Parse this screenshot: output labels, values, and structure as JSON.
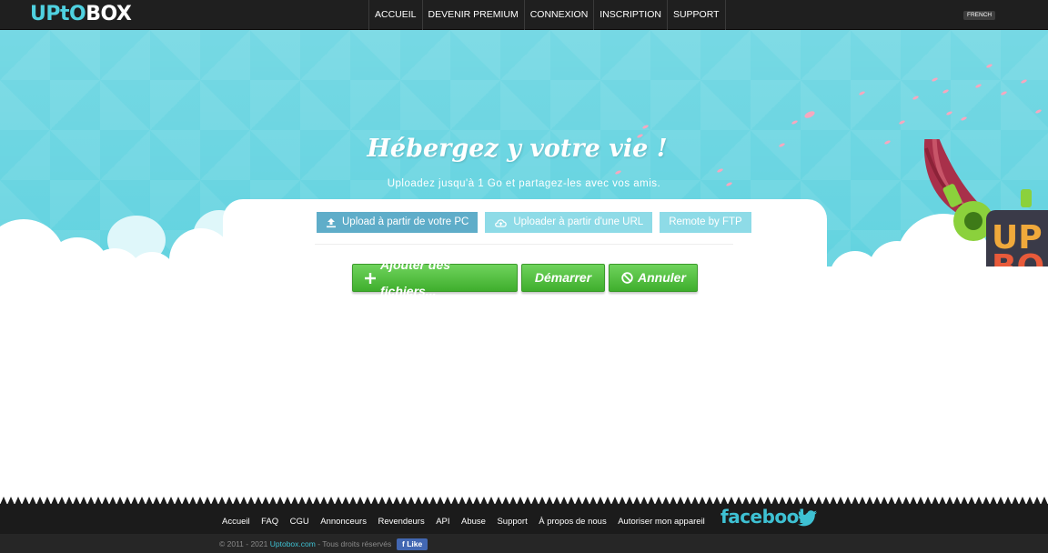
{
  "header": {
    "logo_part1": "UPtO",
    "logo_part2": "BOX",
    "nav": [
      {
        "label": "ACCUEIL"
      },
      {
        "label": "DEVENIR PREMIUM"
      },
      {
        "label": "CONNEXION"
      },
      {
        "label": "INSCRIPTION"
      },
      {
        "label": "SUPPORT"
      }
    ],
    "language": "FRENCH"
  },
  "hero": {
    "title": "Hébergez y votre vie !",
    "subtitle": "Uploadez jusqu'à 1 Go et partagez-les avec vos amis."
  },
  "upload": {
    "tabs": [
      {
        "label": "Upload à partir de votre PC",
        "icon": "upload-icon",
        "active": true
      },
      {
        "label": "Uploader à partir d'une URL",
        "icon": "cloud-upload-icon",
        "active": false
      },
      {
        "label": "Remote by FTP",
        "icon": "",
        "active": false
      }
    ],
    "add_files_label": "Ajouter des fichiers...",
    "start_label": "Démarrer",
    "cancel_label": "Annuler"
  },
  "footer": {
    "links": [
      {
        "label": "Accueil"
      },
      {
        "label": "FAQ"
      },
      {
        "label": "CGU"
      },
      {
        "label": "Annonceurs"
      },
      {
        "label": "Revendeurs"
      },
      {
        "label": "API"
      },
      {
        "label": "Abuse"
      },
      {
        "label": "Support"
      },
      {
        "label": "À propos de nous"
      },
      {
        "label": "Autoriser mon appareil"
      }
    ],
    "facebook_text": "facebook",
    "copyright_prefix": "© 2011 - 2021 ",
    "copyright_site": "Uptobox.com",
    "copyright_suffix": " - Tous droits réservés",
    "like_label": "Like",
    "like_icon": "f"
  },
  "colors": {
    "accent": "#4fd1e0",
    "hero_bg": "#63d3e0",
    "active_tab": "#5fadc9",
    "idle_tab": "#8edbe7",
    "green_button": "#4dbd38",
    "footer_bg": "#1b1b1b"
  }
}
